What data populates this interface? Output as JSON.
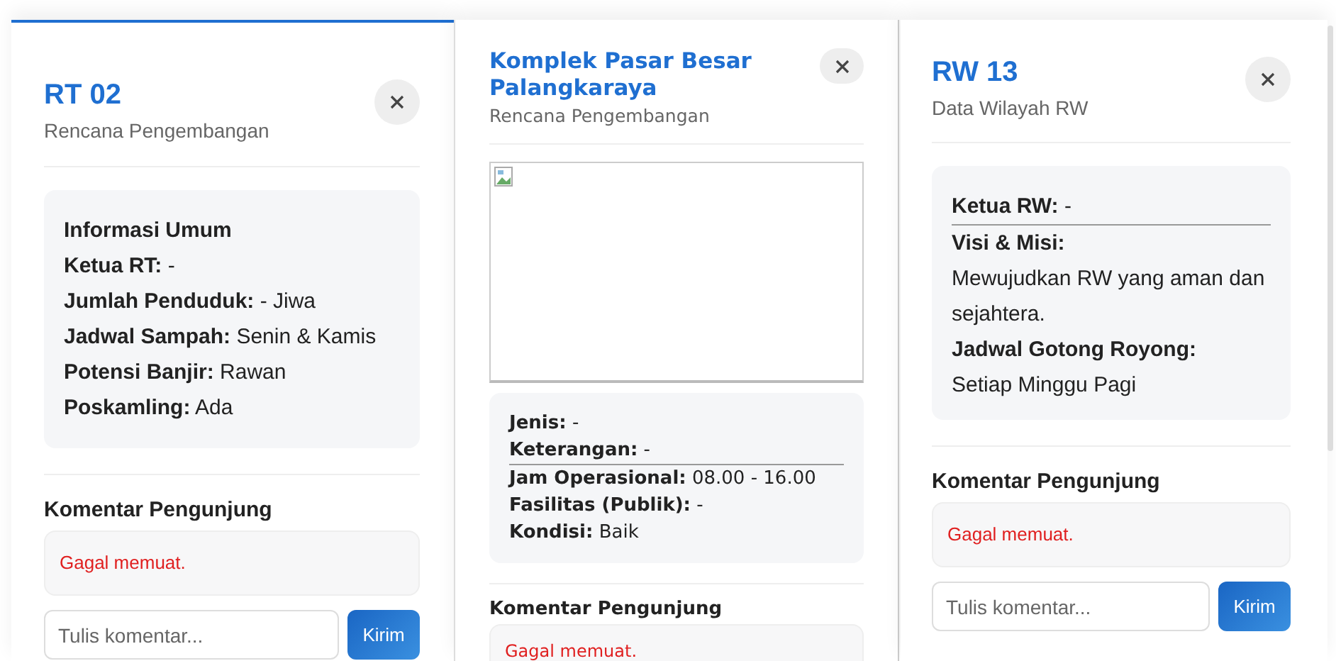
{
  "panels": [
    {
      "title": "RT 02",
      "subtitle": "Rencana Pengembangan",
      "image": false,
      "info": [
        {
          "kind": "heading",
          "text": "Informasi Umum"
        },
        {
          "kind": "field",
          "text": "**Ketua RT:** -"
        },
        {
          "kind": "field",
          "text": "**Jumlah Penduduk:** - Jiwa"
        },
        {
          "kind": "field",
          "text": "**Jadwal Sampah:** Senin & Kamis"
        },
        {
          "kind": "field",
          "text": "**Potensi Banjir:** Rawan"
        },
        {
          "kind": "field",
          "text": "**Poskamling:** Ada"
        }
      ],
      "comments": {
        "title": "Komentar Pengunjung",
        "status": "Gagal memuat.",
        "placeholder": "Tulis komentar...",
        "button": "Kirim"
      }
    },
    {
      "title": "Komplek Pasar Besar Palangkaraya",
      "subtitle": "Rencana Pengembangan",
      "image": true,
      "info": [
        {
          "kind": "field",
          "text": "**Jenis:** -"
        },
        {
          "kind": "field",
          "text": "**Keterangan:** -"
        },
        {
          "kind": "divider"
        },
        {
          "kind": "field",
          "text": "**Jam Operasional:** 08.00 - 16.00"
        },
        {
          "kind": "field",
          "text": "**Fasilitas (Publik):** -"
        },
        {
          "kind": "field",
          "text": "**Kondisi:** Baik"
        }
      ],
      "comments": {
        "title": "Komentar Pengunjung",
        "status": "Gagal memuat."
      }
    },
    {
      "title": "RW 13",
      "subtitle": "Data Wilayah RW",
      "image": false,
      "info": [
        {
          "kind": "field",
          "text": "**Ketua RW:** -"
        },
        {
          "kind": "divider"
        },
        {
          "kind": "label",
          "text": "Visi & Misi:"
        },
        {
          "kind": "text",
          "text": "Mewujudkan RW yang aman dan sejahtera."
        },
        {
          "kind": "label",
          "text": "Jadwal Gotong Royong:"
        },
        {
          "kind": "text",
          "text": "Setiap Minggu Pagi"
        }
      ],
      "comments": {
        "title": "Komentar Pengunjung",
        "status": "Gagal memuat.",
        "placeholder": "Tulis komentar...",
        "button": "Kirim"
      }
    }
  ]
}
